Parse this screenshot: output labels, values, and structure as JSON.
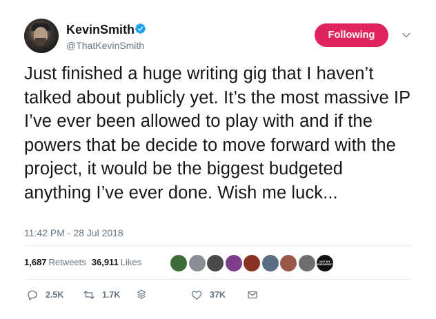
{
  "author": {
    "display_name": "KevinSmith",
    "handle": "@ThatKevinSmith",
    "verified": true,
    "avatar_icon": "avatar"
  },
  "follow_button": {
    "label": "Following",
    "color": "#e0245e"
  },
  "tweet": {
    "text": "Just finished a huge writing gig that I haven’t talked about publicly yet. It’s the most massive IP I’ve ever been allowed to play with and if the powers that be decide to move forward with the project, it would be the biggest budgeted anything I’ve ever done. Wish me luck...",
    "timestamp": "11:42 PM - 28 Jul 2018"
  },
  "stats": {
    "retweets_count": "1,687",
    "retweets_label": "Retweets",
    "likes_count": "36,911",
    "likes_label": "Likes"
  },
  "liker_avatars": [
    {
      "icon": "avatar",
      "color": "#3d6b3a"
    },
    {
      "icon": "avatar",
      "color": "#8b8f95"
    },
    {
      "icon": "avatar",
      "color": "#4a4a4a"
    },
    {
      "icon": "avatar",
      "color": "#7d3f8a"
    },
    {
      "icon": "avatar",
      "color": "#8a3324"
    },
    {
      "icon": "avatar",
      "color": "#5a6d82"
    },
    {
      "icon": "avatar",
      "color": "#9a5a4a"
    },
    {
      "icon": "avatar",
      "color": "#6e6e6e"
    },
    {
      "icon": "avatar",
      "color": "#111111",
      "text": "NOT MY PRESIDENT"
    }
  ],
  "actions": {
    "reply_count": "2.5K",
    "retweet_count": "1.7K",
    "like_count": "37K"
  },
  "colors": {
    "text_primary": "#14171a",
    "text_secondary": "#657786",
    "verified_blue": "#1da1f2",
    "divider": "#e6ecf0"
  }
}
